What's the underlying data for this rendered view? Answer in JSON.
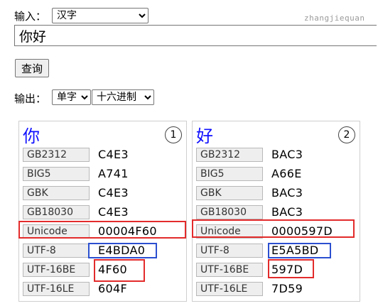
{
  "input": {
    "label": "输入：",
    "type_select": {
      "selected": "汉字"
    },
    "text_value": "你好"
  },
  "watermark": "zhangjiequan",
  "query_button": "查询",
  "output": {
    "label": "输出：",
    "mode_select": {
      "selected": "单字"
    },
    "base_select": {
      "selected": "十六进制"
    }
  },
  "cards": [
    {
      "char": "你",
      "index": "1",
      "rows": [
        {
          "enc": "GB2312",
          "value": "C4E3"
        },
        {
          "enc": "BIG5",
          "value": "A741"
        },
        {
          "enc": "GBK",
          "value": "C4E3"
        },
        {
          "enc": "GB18030",
          "value": "C4E3"
        },
        {
          "enc": "Unicode",
          "value": "00004F60"
        },
        {
          "enc": "UTF-8",
          "value": "E4BDA0"
        },
        {
          "enc": "UTF-16BE",
          "value": "4F60"
        },
        {
          "enc": "UTF-16LE",
          "value": "604F"
        }
      ]
    },
    {
      "char": "好",
      "index": "2",
      "rows": [
        {
          "enc": "GB2312",
          "value": "BAC3"
        },
        {
          "enc": "BIG5",
          "value": "A66E"
        },
        {
          "enc": "GBK",
          "value": "BAC3"
        },
        {
          "enc": "GB18030",
          "value": "BAC3"
        },
        {
          "enc": "Unicode",
          "value": "0000597D"
        },
        {
          "enc": "UTF-8",
          "value": "E5A5BD"
        },
        {
          "enc": "UTF-16BE",
          "value": "597D"
        },
        {
          "enc": "UTF-16LE",
          "value": "7D59"
        }
      ]
    }
  ],
  "highlight_colors": {
    "red": "#e32b2b",
    "blue": "#2b4fd0"
  }
}
